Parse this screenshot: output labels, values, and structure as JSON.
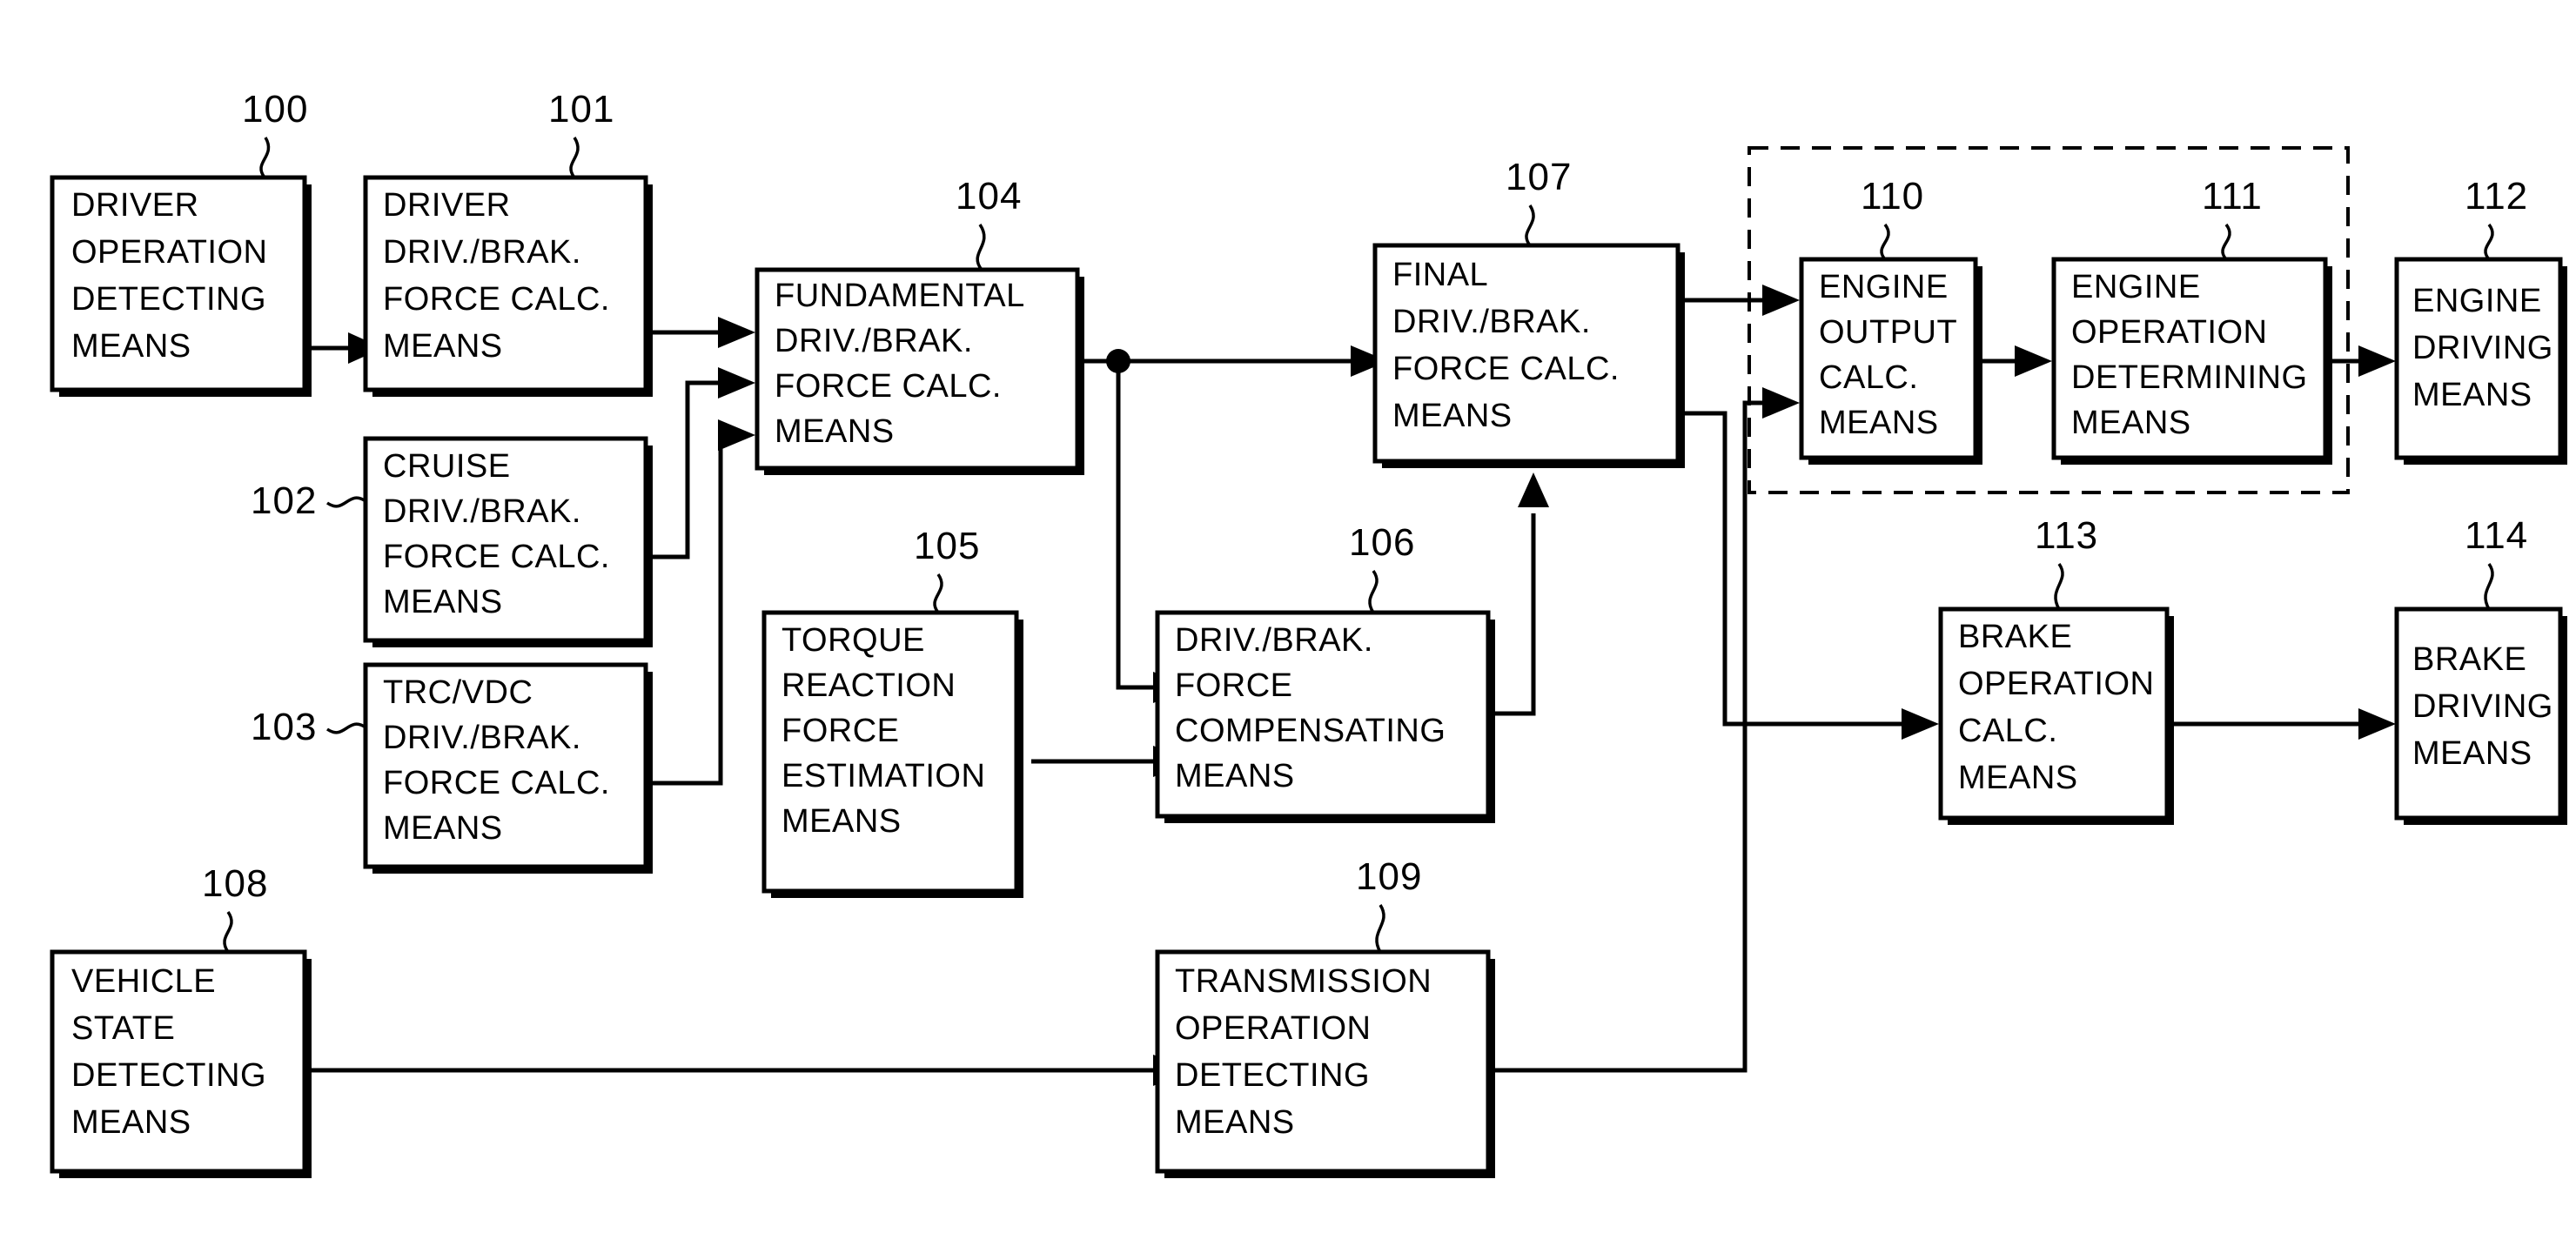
{
  "figure": {
    "title": "Vehicle driving/braking force control block diagram",
    "background_color": "#ffffff",
    "line_color": "#000000"
  },
  "blocks": [
    {
      "id": "100",
      "ref": "100",
      "lines": [
        "DRIVER",
        "OPERATION",
        "DETECTING",
        "MEANS"
      ]
    },
    {
      "id": "101",
      "ref": "101",
      "lines": [
        "DRIVER",
        "DRIV./BRAK.",
        "FORCE  CALC.",
        "MEANS"
      ]
    },
    {
      "id": "102",
      "ref": "102",
      "lines": [
        "CRUISE",
        "DRIV./BRAK.",
        "FORCE  CALC.",
        "MEANS"
      ]
    },
    {
      "id": "103",
      "ref": "103",
      "lines": [
        "TRC/VDC",
        "DRIV./BRAK.",
        "FORCE  CALC.",
        "MEANS"
      ]
    },
    {
      "id": "104",
      "ref": "104",
      "lines": [
        "FUNDAMENTAL",
        "DRIV./BRAK.",
        "FORCE  CALC.",
        "MEANS"
      ]
    },
    {
      "id": "105",
      "ref": "105",
      "lines": [
        "TORQUE",
        "REACTION",
        "FORCE",
        "ESTIMATION",
        "MEANS"
      ]
    },
    {
      "id": "106",
      "ref": "106",
      "lines": [
        "DRIV./BRAK.",
        "FORCE",
        "COMPENSATING",
        "MEANS"
      ]
    },
    {
      "id": "107",
      "ref": "107",
      "lines": [
        "FINAL",
        "DRIV./BRAK.",
        "FORCE  CALC.",
        "MEANS"
      ]
    },
    {
      "id": "108",
      "ref": "108",
      "lines": [
        "VEHICLE",
        "STATE",
        "DETECTING",
        "MEANS"
      ]
    },
    {
      "id": "109",
      "ref": "109",
      "lines": [
        "TRANSMISSION",
        "OPERATION",
        "DETECTING",
        "MEANS"
      ]
    },
    {
      "id": "110",
      "ref": "110",
      "lines": [
        "ENGINE",
        "OUTPUT",
        "CALC.",
        "MEANS"
      ]
    },
    {
      "id": "111",
      "ref": "111",
      "lines": [
        "ENGINE",
        "OPERATION",
        "DETERMINING",
        "MEANS"
      ]
    },
    {
      "id": "112",
      "ref": "112",
      "lines": [
        "ENGINE",
        "DRIVING",
        "MEANS"
      ]
    },
    {
      "id": "113",
      "ref": "113",
      "lines": [
        "BRAKE",
        "OPERATION",
        "CALC.",
        "MEANS"
      ]
    },
    {
      "id": "114",
      "ref": "114",
      "lines": [
        "BRAKE",
        "DRIVING",
        "MEANS"
      ]
    }
  ],
  "group_box": {
    "style": "dashed",
    "contains": [
      "110",
      "111"
    ]
  },
  "connections": [
    {
      "from": "100",
      "to": "101"
    },
    {
      "from": "101",
      "to": "104"
    },
    {
      "from": "102",
      "to": "104"
    },
    {
      "from": "103",
      "to": "104"
    },
    {
      "from": "104",
      "to": "107"
    },
    {
      "from": "104",
      "to": "106"
    },
    {
      "from": "105",
      "to": "106"
    },
    {
      "from": "106",
      "to": "107"
    },
    {
      "from": "107",
      "to": "110"
    },
    {
      "from": "107",
      "to": "113"
    },
    {
      "from": "108",
      "to": "109"
    },
    {
      "from": "109",
      "to": "110"
    },
    {
      "from": "110",
      "to": "111"
    },
    {
      "from": "111",
      "to": "112"
    },
    {
      "from": "113",
      "to": "114"
    }
  ]
}
